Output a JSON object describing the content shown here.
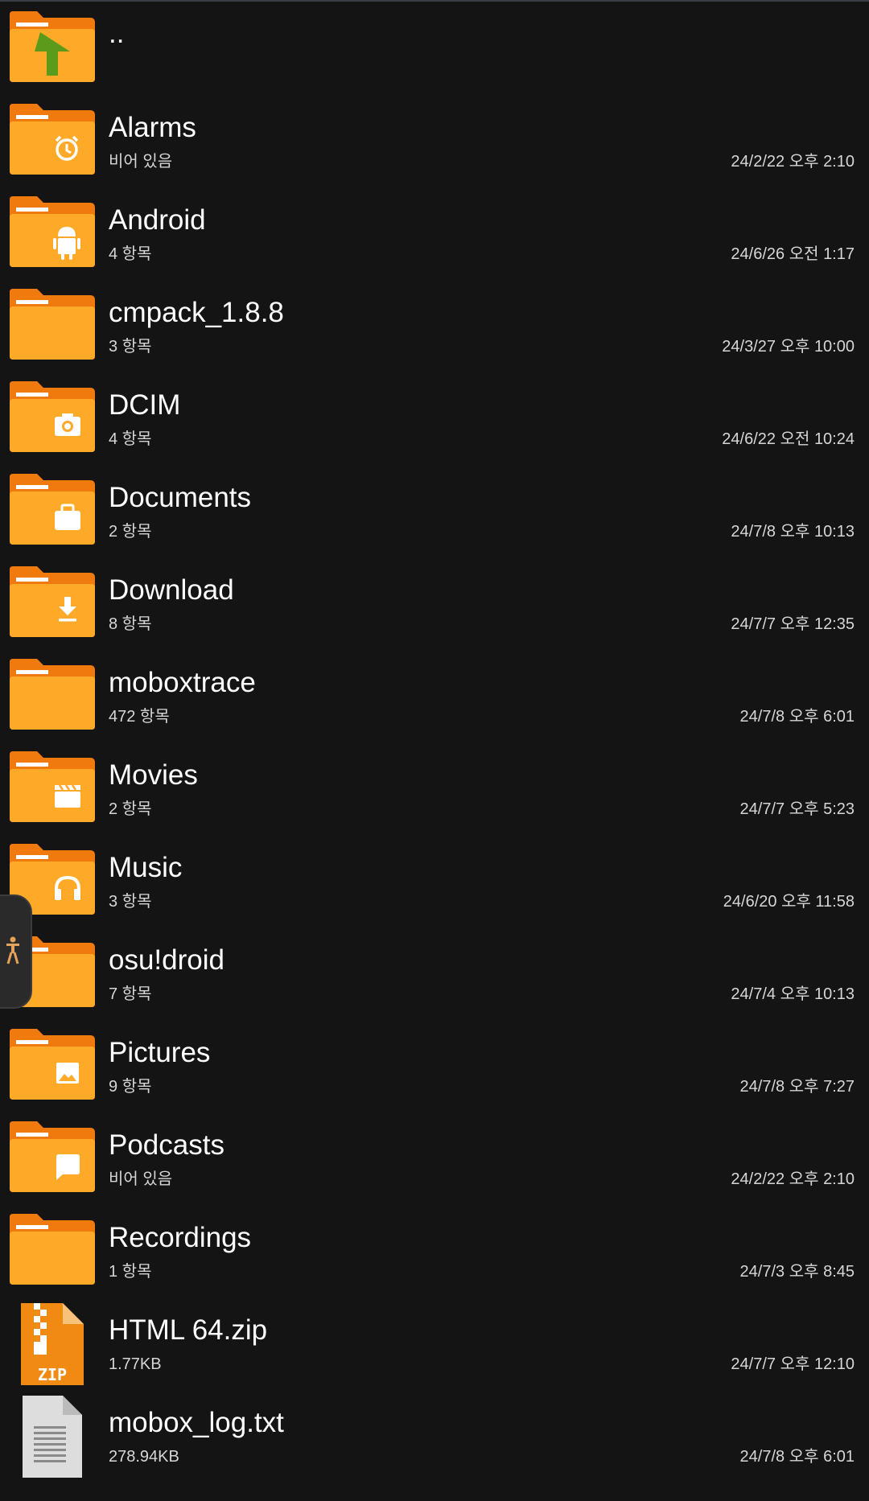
{
  "colors": {
    "background": "#141414",
    "folder_body": "#FFA928",
    "folder_tab": "#F07A0E",
    "folder_glyph": "#FFFFFF",
    "up_arrow": "#5C9A1B",
    "text_primary": "#FFFFFF",
    "text_secondary": "#D6D6D6"
  },
  "parent": {
    "name": "..",
    "icon": "folder-up-icon"
  },
  "entries": [
    {
      "name": "Alarms",
      "detail": "비어 있음",
      "date": "24/2/22 오후 2:10",
      "icon": "alarm-folder-icon"
    },
    {
      "name": "Android",
      "detail": "4 항목",
      "date": "24/6/26 오전 1:17",
      "icon": "android-folder-icon"
    },
    {
      "name": "cmpack_1.8.8",
      "detail": "3 항목",
      "date": "24/3/27 오후 10:00",
      "icon": "folder-icon"
    },
    {
      "name": "DCIM",
      "detail": "4 항목",
      "date": "24/6/22 오전 10:24",
      "icon": "camera-folder-icon"
    },
    {
      "name": "Documents",
      "detail": "2 항목",
      "date": "24/7/8 오후 10:13",
      "icon": "briefcase-folder-icon"
    },
    {
      "name": "Download",
      "detail": "8 항목",
      "date": "24/7/7 오후 12:35",
      "icon": "download-folder-icon"
    },
    {
      "name": "moboxtrace",
      "detail": "472 항목",
      "date": "24/7/8 오후 6:01",
      "icon": "folder-icon"
    },
    {
      "name": "Movies",
      "detail": "2 항목",
      "date": "24/7/7 오후 5:23",
      "icon": "movie-folder-icon"
    },
    {
      "name": "Music",
      "detail": "3 항목",
      "date": "24/6/20 오후 11:58",
      "icon": "headphones-folder-icon"
    },
    {
      "name": "osu!droid",
      "detail": "7 항목",
      "date": "24/7/4 오후 10:13",
      "icon": "folder-icon"
    },
    {
      "name": "Pictures",
      "detail": "9 항목",
      "date": "24/7/8 오후 7:27",
      "icon": "picture-folder-icon"
    },
    {
      "name": "Podcasts",
      "detail": "비어 있음",
      "date": "24/2/22 오후 2:10",
      "icon": "chat-folder-icon"
    },
    {
      "name": "Recordings",
      "detail": "1 항목",
      "date": "24/7/3 오후 8:45",
      "icon": "folder-icon"
    },
    {
      "name": "HTML 64.zip",
      "detail": "1.77KB",
      "date": "24/7/7 오후 12:10",
      "icon": "zip-file-icon",
      "badge": "ZIP"
    },
    {
      "name": "mobox_log.txt",
      "detail": "278.94KB",
      "date": "24/7/8 오후 6:01",
      "icon": "text-file-icon"
    }
  ],
  "side_tab": {
    "icon": "accessibility-person-icon"
  }
}
